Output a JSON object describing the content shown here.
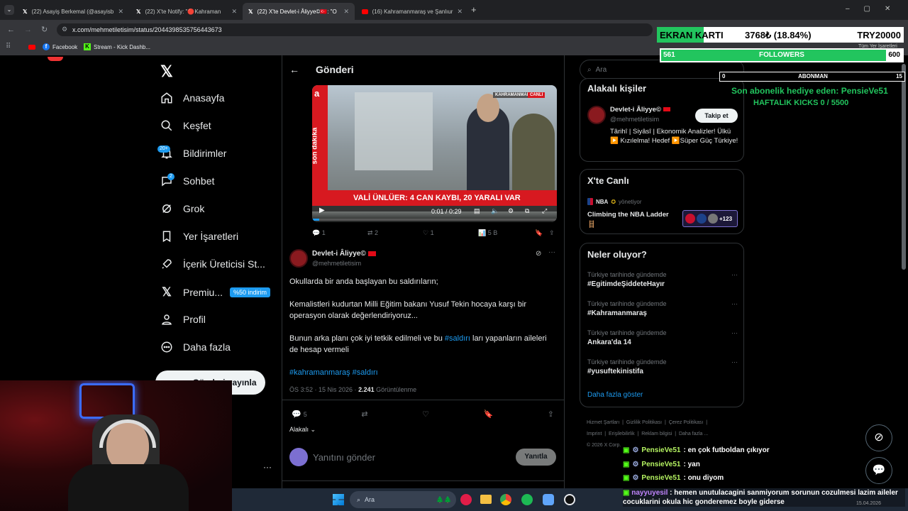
{
  "browser": {
    "tabs": [
      {
        "title": "(22) Asayiş Berkemal (@asayisb",
        "favicon": "x-icon"
      },
      {
        "title": "(22) X'te Notify: \"🔴Kahraman",
        "favicon": "x-icon"
      },
      {
        "title": "(22) X'te Devlet-i Âliyye©🇹🇷: \"O",
        "favicon": "x-icon",
        "active": true
      },
      {
        "title": "(16) Kahramanmaraş ve Şanlıur",
        "favicon": "youtube-icon"
      }
    ],
    "url": "x.com/mehmetiletisim/status/2044398535756443673",
    "bookmarks": [
      "Facebook",
      "Stream - Kick Dashb..."
    ],
    "all_bookmarks": "Tüm Yer İşaretleri"
  },
  "nav": {
    "items": [
      {
        "label": "Anasayfa",
        "icon": "home-icon"
      },
      {
        "label": "Keşfet",
        "icon": "search-icon"
      },
      {
        "label": "Bildirimler",
        "icon": "bell-icon",
        "badge": "20+"
      },
      {
        "label": "Sohbet",
        "icon": "chat-icon",
        "badge": "2"
      },
      {
        "label": "Grok",
        "icon": "grok-icon"
      },
      {
        "label": "Yer İşaretleri",
        "icon": "bookmark-icon"
      },
      {
        "label": "İçerik Üreticisi St...",
        "icon": "rocket-icon"
      },
      {
        "label": "Premiu...",
        "icon": "x-icon",
        "badge": "%50 indirim"
      },
      {
        "label": "Profil",
        "icon": "person-icon"
      },
      {
        "label": "Daha fazla",
        "icon": "more-circle-icon"
      }
    ],
    "post_button": "Gönderi yayınla"
  },
  "header": {
    "title": "Gönderi"
  },
  "video": {
    "lower_third": "VALİ ÜNLÜER: 4 CAN KAYBI, 20 YARALI VAR",
    "tag": "son dakika",
    "location": "KAHRAMANMARAŞ",
    "live": "CANLI",
    "time": "0:01 / 0:29",
    "progress": 0.03
  },
  "quoted_actions": {
    "replies": "1",
    "reposts": "2",
    "likes": "1",
    "views": "5 B"
  },
  "post": {
    "author": "Devlet-i Âliyye©",
    "handle": "@mehmetiletisim",
    "p1": "Okullarda bir anda başlayan bu saldırıların;",
    "p2": "Kemalistleri kudurtan Milli Eğitim bakanı Yusuf Tekin hocaya karşı bir operasyon olarak değerlendiriyoruz...",
    "p3a": "Bunun arka planı çok iyi tetkik edilmeli ve bu ",
    "p3tag": "#saldırı",
    "p3b": " ları yapanların aileleri de hesap vermeli",
    "tags": "#kahramanmaraş #saldırı",
    "time": "ÖS 3:52 · 15 Nis 2026 · ",
    "views": "2.241",
    "views_label": " Görüntülenme",
    "reply_count": "5",
    "relevance": "Alakalı"
  },
  "reply": {
    "placeholder": "Yanıtını gönder",
    "button": "Yanıtla"
  },
  "sidebar": {
    "search_placeholder": "Ara",
    "related_title": "Alakalı kişiler",
    "person": {
      "name": "Devlet-i Âliyye©",
      "handle": "@mehmetiletisim",
      "bio": "Târihî | Siyâsî | Ekonomik Analizler! Ülkü ▶️ Kızılelma! Hedef ▶️Süper Güç Türkiye!",
      "follow": "Takip et"
    },
    "live_title": "X'te Canlı",
    "live": {
      "host": "NBA",
      "host_suffix": "yönetiyor",
      "title": "Climbing the NBA Ladder 🪜",
      "count": "+123"
    },
    "trends_title": "Neler oluyor?",
    "trends": [
      {
        "meta": "Türkiye tarihinde gündemde",
        "name": "#EgitimdeŞiddeteHayır"
      },
      {
        "meta": "Türkiye tarihinde gündemde",
        "name": "#Kahramanmaraş"
      },
      {
        "meta": "Türkiye tarihinde gündemde",
        "name": "Ankara'da 14"
      },
      {
        "meta": "Türkiye tarihinde gündemde",
        "name": "#yusuftekinistifa"
      }
    ],
    "show_more": "Daha fazla göster",
    "footer": [
      "Hizmet Şartları",
      "Gizlilik Politikası",
      "Çerez Politikası",
      "Imprint",
      "Erişilebilirlik",
      "Reklam bilgisi",
      "Daha fazla ...",
      "© 2026 X Corp."
    ]
  },
  "overlay": {
    "ekran_label": "EKRAN KARTI",
    "ekran_value": "3768₺ (18.84%)",
    "ekran_goal": "TRY20000",
    "ekran_progress": 0.1884,
    "followers_label": "FOLLOWERS",
    "followers_current": "561",
    "followers_goal": "600",
    "followers_progress": 0.935,
    "abonman_label": "ABONMAN",
    "abonman_current": "0",
    "abonman_goal": "15",
    "gift_text": "Son abonelik hediye eden: PensieVe51",
    "kicks_text": "HAFTALIK KICKS 0 / 5500"
  },
  "chat": [
    {
      "user": "PensieVe51",
      "msg": " : en çok futboldan çıkıyor",
      "color": "#b6f562"
    },
    {
      "user": "PensieVe51",
      "msg": " : yan",
      "color": "#b6f562"
    },
    {
      "user": "PensieVe51",
      "msg": " : onu diyom",
      "color": "#b6f562"
    },
    {
      "user": "nayyuyesil",
      "msg": " : hemen unutulacagini sanmiyorum sorunun cozulmesi lazim aileler cocuklarini okula hic gonderemez boyle giderse",
      "color": "#c084fc"
    }
  ],
  "taskbar": {
    "search": "Ara",
    "date": "15.04.2026"
  },
  "colors": {
    "accent": "#1d9bf0",
    "kick_green": "#53fc18",
    "overlay_green": "#22c55e"
  }
}
